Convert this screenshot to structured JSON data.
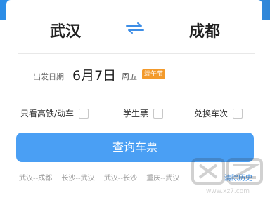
{
  "route": {
    "from_city": "武汉",
    "to_city": "成都"
  },
  "date": {
    "label": "出发日期",
    "value": "6月7日",
    "weekday": "周五",
    "holiday_badge": "端午节"
  },
  "options": {
    "high_speed_label": "只看高铁/动车",
    "student_label": "学生票",
    "exchange_label": "兑换车次"
  },
  "search_button_label": "查询车票",
  "history": {
    "items": [
      "武汉--成都",
      "长沙--武汉",
      "武汉--长沙",
      "重庆--武汉"
    ],
    "clear_label": "清除历史"
  },
  "watermark": {
    "site": "www.xz7.com"
  },
  "colors": {
    "accent": "#4a9ff4",
    "badge": "#f39a2b",
    "swap_icon": "#3e8ee6"
  }
}
